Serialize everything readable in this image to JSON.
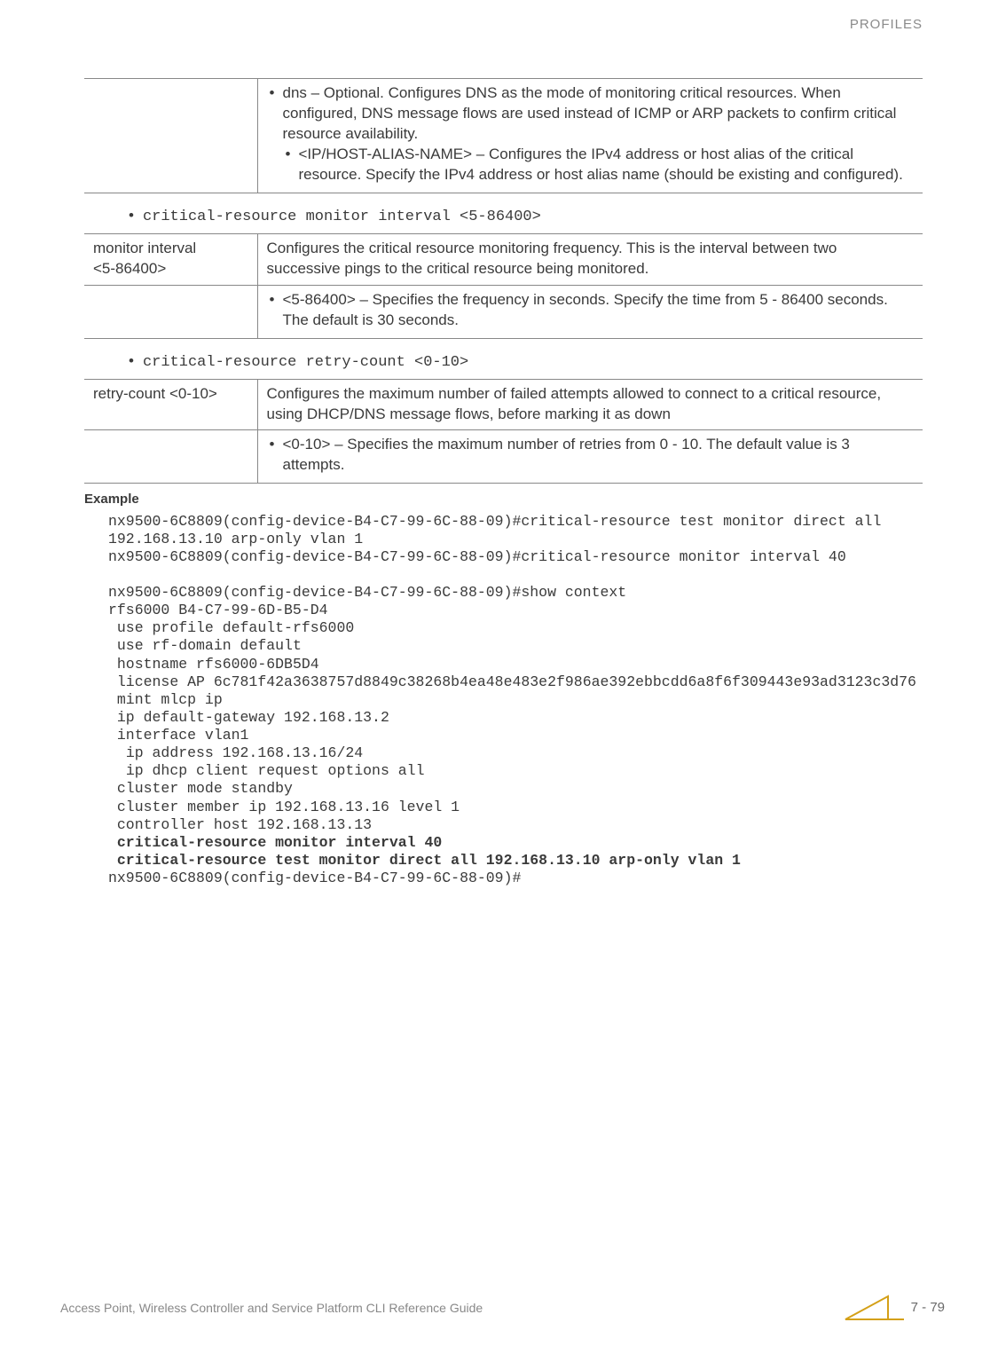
{
  "header": {
    "section": "PROFILES"
  },
  "table1": {
    "dns_line": "dns – Optional. Configures DNS as the mode of monitoring critical resources. When configured, DNS message flows are used instead of ICMP or ARP packets to confirm critical resource availability.",
    "ip_line": "<IP/HOST-ALIAS-NAME> – Configures the IPv4 address or host alias of the critical resource. Specify the IPv4 address or host alias name (should be existing and configured)."
  },
  "syntax1": "critical-resource monitor interval <5-86400>",
  "table2": {
    "param": "monitor interval",
    "param2": "<5-86400>",
    "desc": "Configures the critical resource monitoring frequency. This is the interval between two successive pings to the critical resource being monitored.",
    "bullet": "<5-86400> – Specifies the frequency in seconds. Specify the time from 5 - 86400 seconds. The default is 30 seconds."
  },
  "syntax2": "critical-resource retry-count <0-10>",
  "table3": {
    "param": "retry-count <0-10>",
    "desc": "Configures the maximum number of failed attempts allowed to connect to a critical resource, using DHCP/DNS message flows, before marking it as down",
    "bullet": "<0-10> – Specifies the maximum number of retries from 0 - 10. The default value is 3 attempts."
  },
  "example_heading": "Example",
  "code": {
    "l1": "nx9500-6C8809(config-device-B4-C7-99-6C-88-09)#critical-resource test monitor direct all 192.168.13.10 arp-only vlan 1",
    "l2": "nx9500-6C8809(config-device-B4-C7-99-6C-88-09)#critical-resource monitor interval 40",
    "l3": "",
    "l4": "nx9500-6C8809(config-device-B4-C7-99-6C-88-09)#show context",
    "l5": "rfs6000 B4-C7-99-6D-B5-D4",
    "l6": " use profile default-rfs6000",
    "l7": " use rf-domain default",
    "l8": " hostname rfs6000-6DB5D4",
    "l9": " license AP 6c781f42a3638757d8849c38268b4ea48e483e2f986ae392ebbcdd6a8f6f309443e93ad3123c3d76",
    "l10": " mint mlcp ip",
    "l11": " ip default-gateway 192.168.13.2",
    "l12": " interface vlan1",
    "l13": "  ip address 192.168.13.16/24",
    "l14": "  ip dhcp client request options all",
    "l15": " cluster mode standby",
    "l16": " cluster member ip 192.168.13.16 level 1",
    "l17": " controller host 192.168.13.13",
    "b1": " critical-resource monitor interval 40",
    "b2": " critical-resource test monitor direct all 192.168.13.10 arp-only vlan 1",
    "l18": "nx9500-6C8809(config-device-B4-C7-99-6C-88-09)#"
  },
  "footer": {
    "title": "Access Point, Wireless Controller and Service Platform CLI Reference Guide",
    "page": "7 - 79"
  }
}
